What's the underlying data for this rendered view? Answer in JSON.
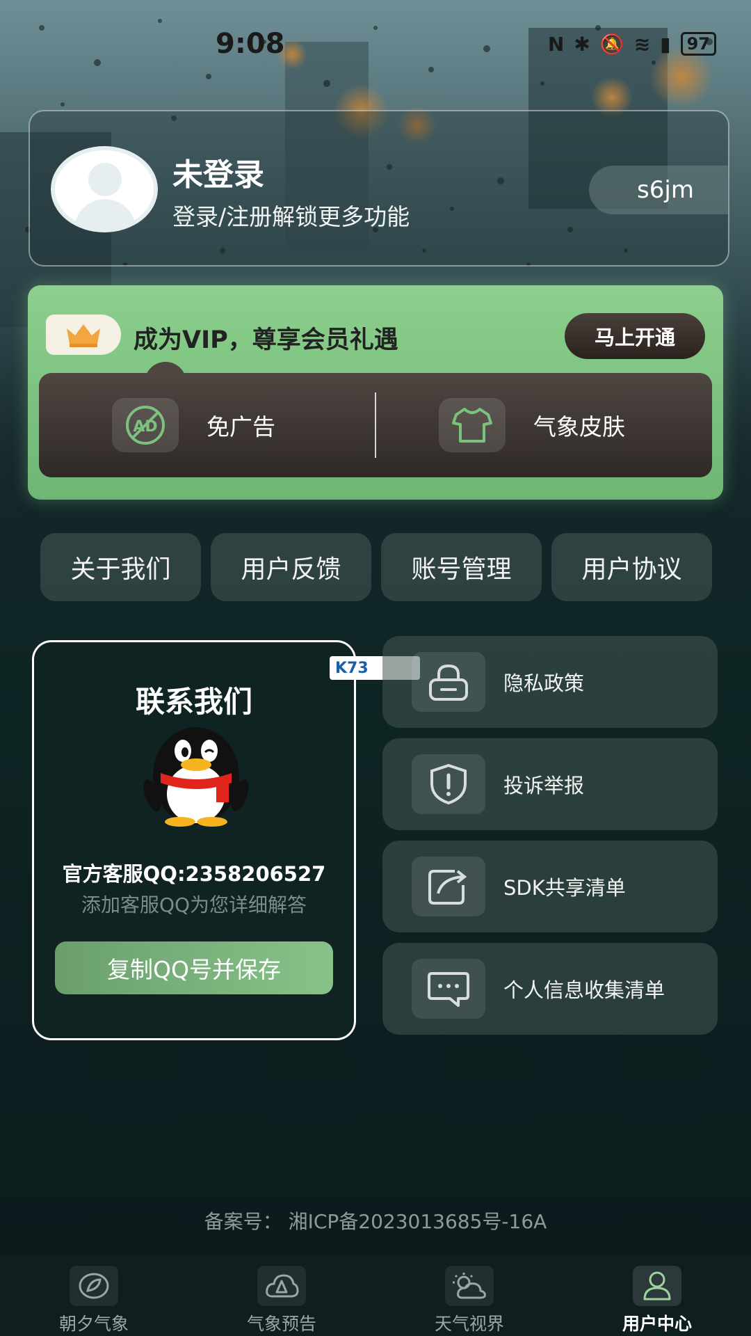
{
  "status_bar": {
    "time": "9:08",
    "battery": "97"
  },
  "profile": {
    "title": "未登录",
    "subtitle": "登录/注册解锁更多功能",
    "code": "s6jm"
  },
  "vip": {
    "promo_text": "成为VIP，尊享会员礼遇",
    "open_label": "马上开通",
    "benefits": [
      {
        "label": "免广告",
        "icon": "no-ad-icon"
      },
      {
        "label": "气象皮肤",
        "icon": "shirt-icon"
      }
    ]
  },
  "quick_links": [
    "关于我们",
    "用户反馈",
    "账号管理",
    "用户协议"
  ],
  "contact": {
    "title": "联系我们",
    "qq_line": "官方客服QQ:2358206527",
    "sub": "添加客服QQ为您详细解答",
    "copy_label": "复制QQ号并保存"
  },
  "policies": [
    {
      "label": "隐私政策",
      "icon": "lock-icon"
    },
    {
      "label": "投诉举报",
      "icon": "shield-alert-icon"
    },
    {
      "label": "SDK共享清单",
      "icon": "share-icon"
    },
    {
      "label": "个人信息收集清单",
      "icon": "message-icon"
    }
  ],
  "watermark": "K73",
  "icp": "备案号：  湘ICP备2023013685号-16A",
  "tabs": [
    {
      "label": "朝夕气象",
      "icon": "leaf-icon",
      "active": false
    },
    {
      "label": "气象预告",
      "icon": "cloud-alert-icon",
      "active": false
    },
    {
      "label": "天气视界",
      "icon": "sun-cloud-icon",
      "active": false
    },
    {
      "label": "用户中心",
      "icon": "user-icon",
      "active": true
    }
  ]
}
